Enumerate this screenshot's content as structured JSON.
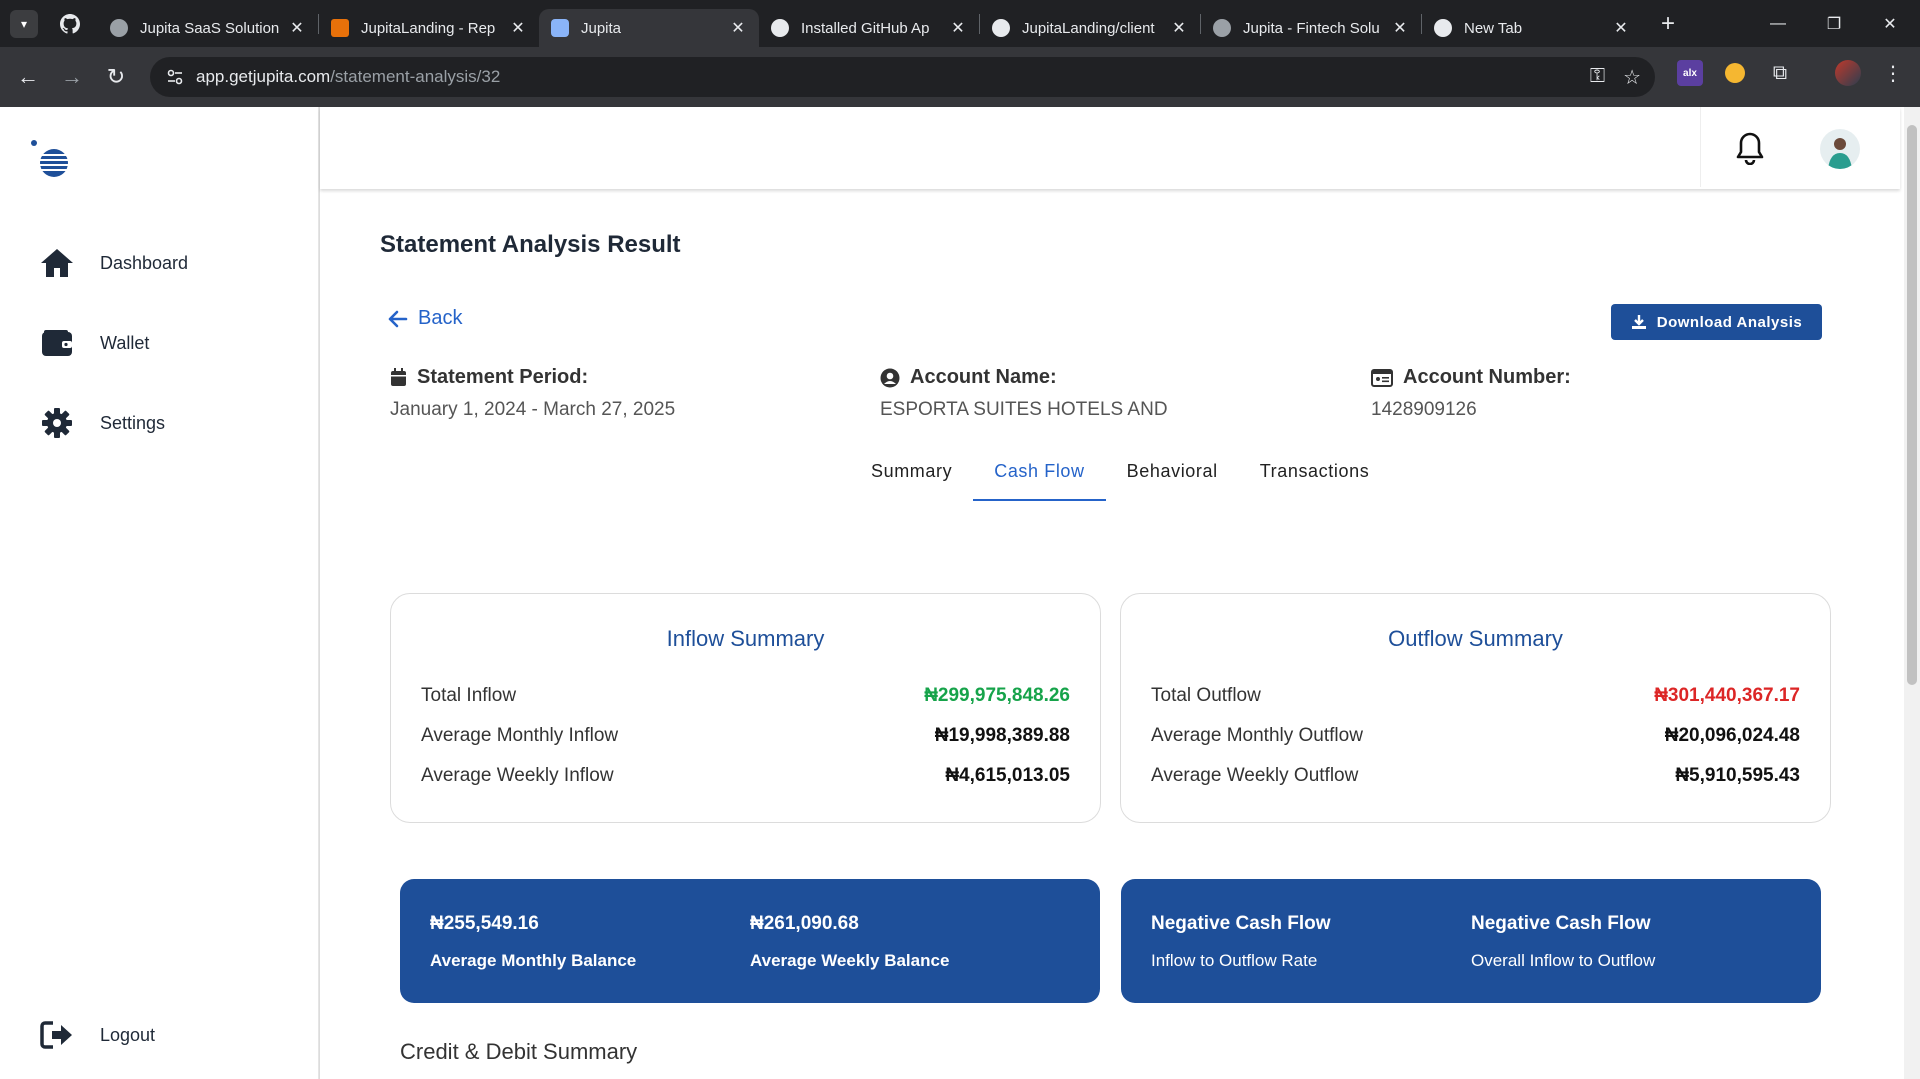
{
  "browser": {
    "tabs": [
      {
        "title": "Jupita SaaS Solution",
        "fav_color": "#9aa0a6"
      },
      {
        "title": "JupitaLanding - Rep",
        "fav_color": "#e8710a"
      },
      {
        "title": "Jupita",
        "fav_color": "#8ab4f8",
        "active": true
      },
      {
        "title": "Installed GitHub Ap",
        "fav_color": "#ffffff"
      },
      {
        "title": "JupitaLanding/client",
        "fav_color": "#ffffff"
      },
      {
        "title": "Jupita - Fintech Solu",
        "fav_color": "#9aa0a6"
      },
      {
        "title": "New Tab",
        "fav_color": "#e8eaed"
      }
    ],
    "url_host": "app.getjupita.com",
    "url_path": "/statement-analysis/32"
  },
  "sidebar": {
    "items": [
      {
        "label": "Dashboard",
        "icon": "home-icon"
      },
      {
        "label": "Wallet",
        "icon": "wallet-icon"
      },
      {
        "label": "Settings",
        "icon": "gear-icon"
      }
    ],
    "logout": "Logout"
  },
  "page": {
    "title": "Statement Analysis Result",
    "back": "Back",
    "download": "Download Analysis"
  },
  "meta": {
    "period_label": "Statement Period:",
    "period_value": "January 1, 2024 - March 27, 2025",
    "name_label": "Account Name:",
    "name_value": "ESPORTA SUITES HOTELS AND",
    "number_label": "Account Number:",
    "number_value": "1428909126"
  },
  "tabs": [
    "Summary",
    "Cash Flow",
    "Behavioral",
    "Transactions"
  ],
  "active_tab": "Cash Flow",
  "inflow": {
    "title": "Inflow Summary",
    "rows": [
      {
        "label": "Total Inflow",
        "value": "₦299,975,848.26"
      },
      {
        "label": "Average Monthly Inflow",
        "value": "₦19,998,389.88"
      },
      {
        "label": "Average Weekly Inflow",
        "value": "₦4,615,013.05"
      }
    ]
  },
  "outflow": {
    "title": "Outflow Summary",
    "rows": [
      {
        "label": "Total Outflow",
        "value": "₦301,440,367.17"
      },
      {
        "label": "Average Monthly Outflow",
        "value": "₦20,096,024.48"
      },
      {
        "label": "Average Weekly Outflow",
        "value": "₦5,910,595.43"
      }
    ]
  },
  "balances": {
    "monthly_value": "₦255,549.16",
    "monthly_label": "Average Monthly Balance",
    "weekly_value": "₦261,090.68",
    "weekly_label": "Average Weekly Balance"
  },
  "cashflow": {
    "rate_value": "Negative Cash Flow",
    "rate_label": "Inflow to Outflow Rate",
    "overall_value": "Negative Cash Flow",
    "overall_label": "Overall Inflow to Outflow"
  },
  "section": "Credit & Debit Summary",
  "colors": {
    "brand": "#1e4f99",
    "link": "#2563c9",
    "positive": "#16a34a",
    "negative": "#dc2626"
  }
}
